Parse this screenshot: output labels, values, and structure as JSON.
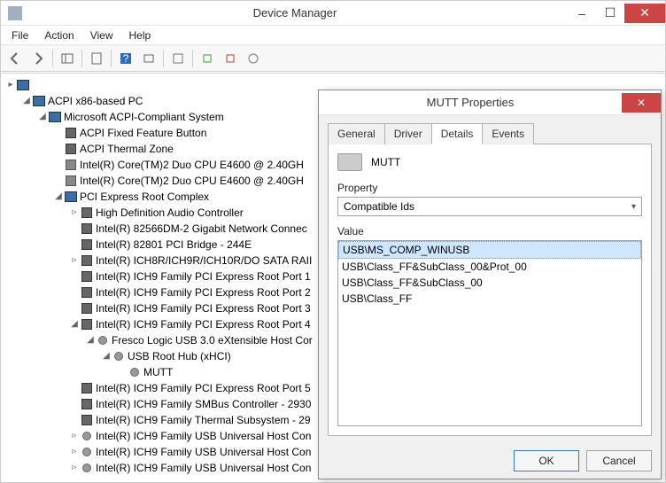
{
  "window": {
    "title": "Device Manager",
    "menus": [
      "File",
      "Action",
      "View",
      "Help"
    ],
    "win_min": "–",
    "win_max": "☐",
    "win_close": "✕"
  },
  "tree": [
    {
      "ind": 0,
      "tw": "▸",
      "icon": "comp",
      "label": ""
    },
    {
      "ind": 1,
      "tw": "◢",
      "icon": "comp",
      "label": "ACPI x86-based PC"
    },
    {
      "ind": 2,
      "tw": "◢",
      "icon": "comp",
      "label": "Microsoft ACPI-Compliant System"
    },
    {
      "ind": 3,
      "tw": "",
      "icon": "chip",
      "label": "ACPI Fixed Feature Button"
    },
    {
      "ind": 3,
      "tw": "",
      "icon": "chip",
      "label": "ACPI Thermal Zone"
    },
    {
      "ind": 3,
      "tw": "",
      "icon": "cpu",
      "label": "Intel(R) Core(TM)2 Duo CPU   E4600 @ 2.40GH"
    },
    {
      "ind": 3,
      "tw": "",
      "icon": "cpu",
      "label": "Intel(R) Core(TM)2 Duo CPU   E4600 @ 2.40GH"
    },
    {
      "ind": 3,
      "tw": "◢",
      "icon": "comp",
      "label": "PCI Express Root Complex"
    },
    {
      "ind": 4,
      "tw": "▹",
      "icon": "chip",
      "label": "High Definition Audio Controller"
    },
    {
      "ind": 4,
      "tw": "",
      "icon": "chip",
      "label": "Intel(R) 82566DM-2 Gigabit Network Connec"
    },
    {
      "ind": 4,
      "tw": "",
      "icon": "chip",
      "label": "Intel(R) 82801 PCI Bridge - 244E"
    },
    {
      "ind": 4,
      "tw": "▹",
      "icon": "chip",
      "label": "Intel(R) ICH8R/ICH9R/ICH10R/DO SATA RAII"
    },
    {
      "ind": 4,
      "tw": "",
      "icon": "chip",
      "label": "Intel(R) ICH9 Family PCI Express Root Port 1"
    },
    {
      "ind": 4,
      "tw": "",
      "icon": "chip",
      "label": "Intel(R) ICH9 Family PCI Express Root Port 2"
    },
    {
      "ind": 4,
      "tw": "",
      "icon": "chip",
      "label": "Intel(R) ICH9 Family PCI Express Root Port 3"
    },
    {
      "ind": 4,
      "tw": "◢",
      "icon": "chip",
      "label": "Intel(R) ICH9 Family PCI Express Root Port 4"
    },
    {
      "ind": 5,
      "tw": "◢",
      "icon": "usb",
      "label": "Fresco Logic USB 3.0 eXtensible Host Cor"
    },
    {
      "ind": 6,
      "tw": "◢",
      "icon": "usb",
      "label": "USB Root Hub (xHCI)"
    },
    {
      "ind": 7,
      "tw": "",
      "icon": "usb",
      "label": "MUTT"
    },
    {
      "ind": 4,
      "tw": "",
      "icon": "chip",
      "label": "Intel(R) ICH9 Family PCI Express Root Port 5"
    },
    {
      "ind": 4,
      "tw": "",
      "icon": "chip",
      "label": "Intel(R) ICH9 Family SMBus Controller - 2930"
    },
    {
      "ind": 4,
      "tw": "",
      "icon": "chip",
      "label": "Intel(R) ICH9 Family Thermal Subsystem - 29"
    },
    {
      "ind": 4,
      "tw": "▹",
      "icon": "usb",
      "label": "Intel(R) ICH9 Family USB Universal Host Con"
    },
    {
      "ind": 4,
      "tw": "▹",
      "icon": "usb",
      "label": "Intel(R) ICH9 Family USB Universal Host Con"
    },
    {
      "ind": 4,
      "tw": "▹",
      "icon": "usb",
      "label": "Intel(R) ICH9 Family USB Universal Host Con"
    }
  ],
  "dialog": {
    "title": "MUTT Properties",
    "close": "✕",
    "tabs": [
      "General",
      "Driver",
      "Details",
      "Events"
    ],
    "active_tab": 2,
    "device_name": "MUTT",
    "property_label": "Property",
    "property_value": "Compatible Ids",
    "value_label": "Value",
    "values": [
      "USB\\MS_COMP_WINUSB",
      "USB\\Class_FF&SubClass_00&Prot_00",
      "USB\\Class_FF&SubClass_00",
      "USB\\Class_FF"
    ],
    "selected_value": 0,
    "ok": "OK",
    "cancel": "Cancel"
  }
}
